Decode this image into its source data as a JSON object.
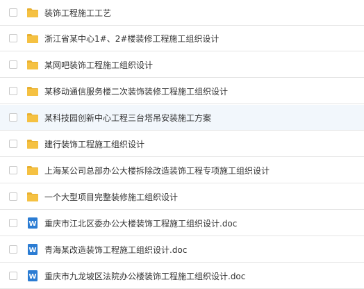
{
  "files": [
    {
      "name": "装饰工程施工工艺",
      "type": "folder-icon"
    },
    {
      "name": "浙江省某中心1#、2#楼装修工程施工组织设计",
      "type": "folder-icon"
    },
    {
      "name": "某网吧装饰工程施工组织设计",
      "type": "folder-icon"
    },
    {
      "name": "某移动通信服务楼二次装饰装修工程施工组织设计",
      "type": "folder-icon"
    },
    {
      "name": "某科技园创新中心工程三台塔吊安装施工方案",
      "type": "folder-icon"
    },
    {
      "name": "建行装饰工程施工组织设计",
      "type": "folder-icon"
    },
    {
      "name": "上海某公司总部办公大楼拆除改造装饰工程专项施工组织设计",
      "type": "folder-icon"
    },
    {
      "name": "一个大型项目完整装修施工组织设计",
      "type": "folder-icon"
    },
    {
      "name": "重庆市江北区委办公大楼装饰工程施工组织设计.doc",
      "type": "word-doc-icon"
    },
    {
      "name": "青海某改造装饰工程施工组织设计.doc",
      "type": "word-doc-icon"
    },
    {
      "name": "重庆市九龙坡区法院办公楼装饰工程施工组织设计.doc",
      "type": "word-doc-icon"
    }
  ],
  "colors": {
    "folder": "#f5c142",
    "folder_tab": "#e8b030",
    "word": "#2b7cd3",
    "hover_row": "#f2f7fc"
  }
}
